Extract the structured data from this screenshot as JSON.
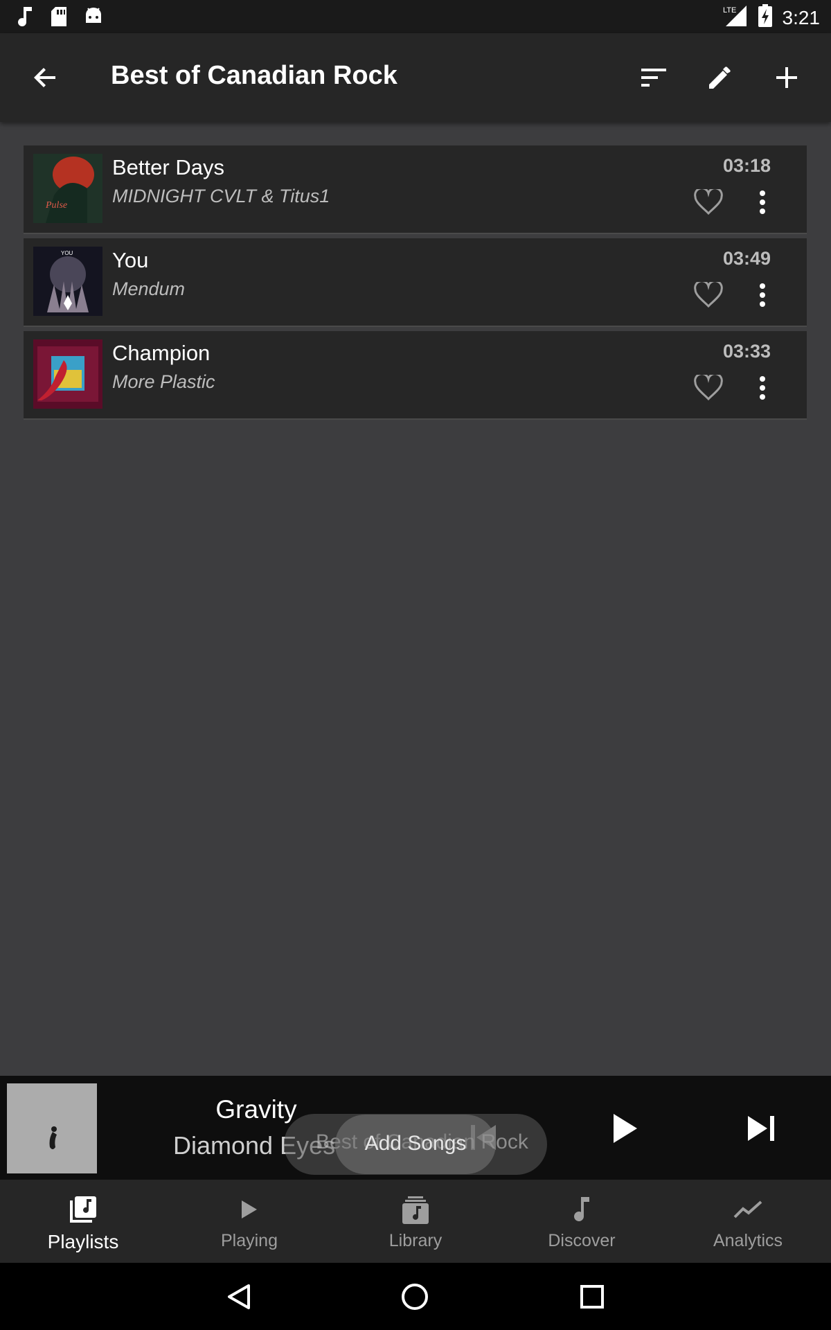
{
  "status_bar": {
    "time": "3:21",
    "network": "LTE",
    "icons": [
      "music-note-icon",
      "sd-card-icon",
      "android-icon",
      "signal-icon",
      "battery-charging-icon"
    ]
  },
  "toolbar": {
    "title": "Best of Canadian Rock",
    "back_icon": "arrow-back-icon",
    "actions": [
      "sort-icon",
      "edit-icon",
      "add-icon"
    ]
  },
  "songs": [
    {
      "title": "Better Days",
      "artist": "MIDNIGHT CVLT & Titus1",
      "duration": "03:18"
    },
    {
      "title": "You",
      "artist": "Mendum",
      "duration": "03:49"
    },
    {
      "title": "Champion",
      "artist": "More Plastic",
      "duration": "03:33"
    }
  ],
  "now_playing": {
    "title": "Gravity",
    "artist": "Diamond Eyes"
  },
  "toast": {
    "label": "Add Songs",
    "background_text": "Best of Canadian Rock"
  },
  "bottom_nav": {
    "items": [
      {
        "label": "Playlists",
        "icon": "playlist-icon",
        "active": true
      },
      {
        "label": "Playing",
        "icon": "play-icon",
        "active": false
      },
      {
        "label": "Library",
        "icon": "library-icon",
        "active": false
      },
      {
        "label": "Discover",
        "icon": "music-note-icon",
        "active": false
      },
      {
        "label": "Analytics",
        "icon": "trend-icon",
        "active": false
      }
    ]
  },
  "colors": {
    "background": "#3d3d3f",
    "surface": "#262626",
    "player": "#0e0e0e",
    "text_secondary": "#bdbdbd"
  }
}
